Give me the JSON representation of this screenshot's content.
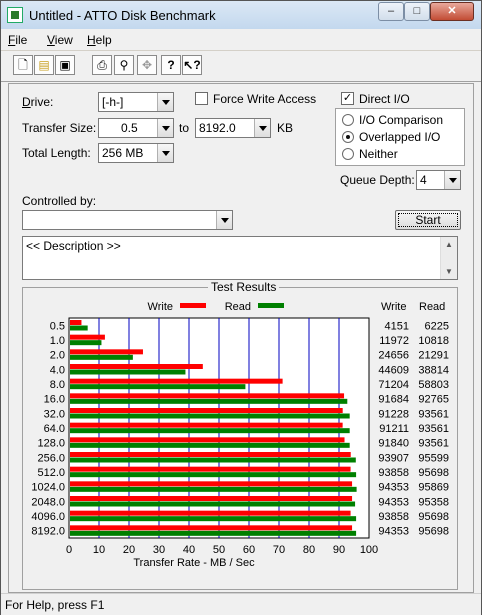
{
  "window": {
    "title": "Untitled - ATTO Disk Benchmark"
  },
  "menu": [
    {
      "key": "F",
      "rest": "ile"
    },
    {
      "key": "V",
      "rest": "iew"
    },
    {
      "key": "H",
      "rest": "elp"
    }
  ],
  "toolbar": [
    "new-icon",
    "open-icon",
    "save-icon",
    "print-icon",
    "print-preview-icon",
    "move-icon",
    "help-icon",
    "context-help-icon"
  ],
  "form": {
    "drive_label": "Drive:",
    "drive_key": "D",
    "drive_value": "[-h-]",
    "force_write_label": "Force Write Access",
    "force_write_key": "W",
    "force_write_checked": false,
    "direct_io_label": "Direct I/O",
    "direct_io_key": "D",
    "direct_io_checked": true,
    "transfer_size_label": "Transfer Size:",
    "transfer_from": "0.5",
    "transfer_to_label": "to",
    "transfer_to": "8192.0",
    "transfer_unit": "KB",
    "total_length_label": "Total Length:",
    "total_length_value": "256 MB",
    "io_comparison_label": "I/O Comparison",
    "overlapped_io_label": "Overlapped I/O",
    "neither_label": "Neither",
    "selected_mode": "overlapped",
    "queue_depth_label": "Queue Depth:",
    "queue_depth_value": "4",
    "controlled_by_label": "Controlled by:",
    "controlled_by_value": "",
    "start_label": "Start",
    "description": "<< Description >>"
  },
  "results": {
    "title": "Test Results",
    "legend_write": "Write",
    "legend_read": "Read",
    "col_write": "Write",
    "col_read": "Read",
    "write_color": "#ff0000",
    "read_color": "#008000",
    "grid_color": "#0000c0"
  },
  "chart_data": {
    "type": "bar",
    "title": "Test Results",
    "xlabel": "Transfer Rate - MB / Sec",
    "xlim": [
      0,
      100
    ],
    "xticks": [
      0,
      10,
      20,
      30,
      40,
      50,
      60,
      70,
      80,
      90,
      100
    ],
    "categories": [
      "0.5",
      "1.0",
      "2.0",
      "4.0",
      "8.0",
      "16.0",
      "32.0",
      "64.0",
      "128.0",
      "256.0",
      "512.0",
      "1024.0",
      "2048.0",
      "4096.0",
      "8192.0"
    ],
    "series": [
      {
        "name": "Write",
        "color": "#ff0000",
        "values": [
          4151,
          11972,
          24656,
          44609,
          71204,
          91684,
          91228,
          91211,
          91840,
          93907,
          93858,
          94353,
          94353,
          93858,
          94353
        ]
      },
      {
        "name": "Read",
        "color": "#008000",
        "values": [
          6225,
          10818,
          21291,
          38814,
          58803,
          92765,
          93561,
          93561,
          93561,
          95599,
          95698,
          95869,
          95358,
          95698,
          95698
        ]
      }
    ]
  },
  "status": "For Help, press F1"
}
